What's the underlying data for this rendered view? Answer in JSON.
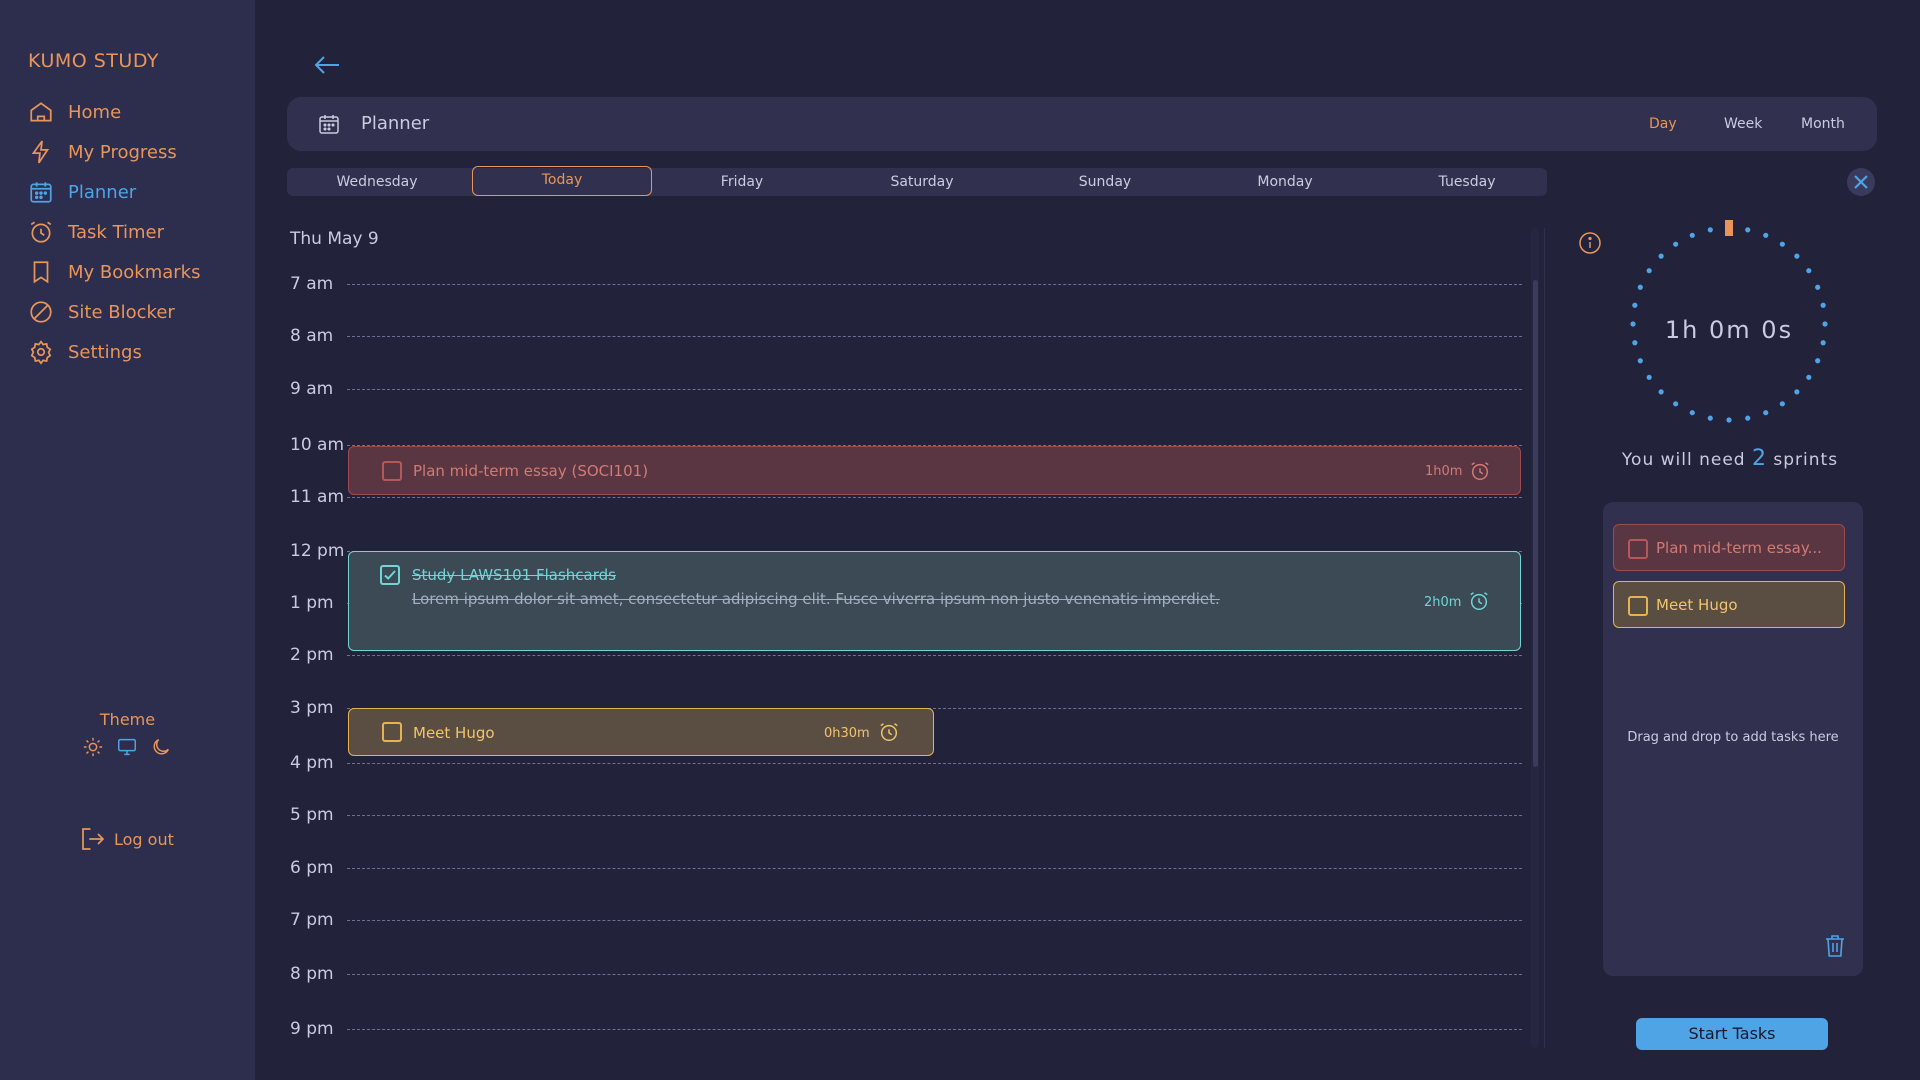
{
  "app": {
    "brand": "KUMO STUDY"
  },
  "sidebar": {
    "items": [
      {
        "label": "Home",
        "icon": "home-icon"
      },
      {
        "label": "My Progress",
        "icon": "lightning-icon"
      },
      {
        "label": "Planner",
        "icon": "calendar-icon",
        "active": true
      },
      {
        "label": "Task Timer",
        "icon": "alarm-clock-icon"
      },
      {
        "label": "My Bookmarks",
        "icon": "bookmark-icon"
      },
      {
        "label": "Site Blocker",
        "icon": "block-icon"
      },
      {
        "label": "Settings",
        "icon": "gear-icon"
      }
    ],
    "theme_label": "Theme",
    "theme_options": [
      "sun-icon",
      "monitor-icon",
      "moon-icon"
    ],
    "logout_label": "Log out"
  },
  "header": {
    "title": "Planner",
    "views": [
      "Day",
      "Week",
      "Month"
    ],
    "active_view": "Day"
  },
  "days": [
    "Wednesday",
    "Today",
    "Friday",
    "Saturday",
    "Sunday",
    "Monday",
    "Tuesday"
  ],
  "active_day": "Today",
  "schedule": {
    "date_title": "Thu May 9",
    "hours": [
      "7 am",
      "8 am",
      "9 am",
      "10 am",
      "11 am",
      "12 pm",
      "1 pm",
      "2 pm",
      "3 pm",
      "4 pm",
      "5 pm",
      "6 pm",
      "7 pm",
      "8 pm",
      "9 pm"
    ],
    "events": [
      {
        "title": "Plan mid-term essay (SOCI101)",
        "duration": "1h0m",
        "completed": false,
        "color": "#d37b73"
      },
      {
        "title": "Study LAWS101 Flashcards",
        "description": "Lorem ipsum dolor sit amet, consectetur adipiscing elit. Fusce viverra ipsum non justo venenatis imperdiet.",
        "duration": "2h0m",
        "completed": true,
        "color": "#6fd6d5"
      },
      {
        "title": "Meet Hugo",
        "duration": "0h30m",
        "completed": false,
        "color": "#f0c56c"
      }
    ]
  },
  "timer": {
    "display": "1h 0m 0s",
    "sprints_prefix": "You will need",
    "sprints_count": "2",
    "sprints_suffix": "sprints"
  },
  "task_panel": {
    "tasks": [
      {
        "label": "Plan mid-term essay...",
        "color": "#d37b73"
      },
      {
        "label": "Meet Hugo",
        "color": "#f0c56c"
      }
    ],
    "drop_hint": "Drag and drop to add tasks here",
    "start_label": "Start Tasks"
  },
  "colors": {
    "accent_orange": "#e8955a",
    "accent_blue": "#4fa4e6",
    "background": "#22223a",
    "sidebar": "#2d2d4d"
  }
}
